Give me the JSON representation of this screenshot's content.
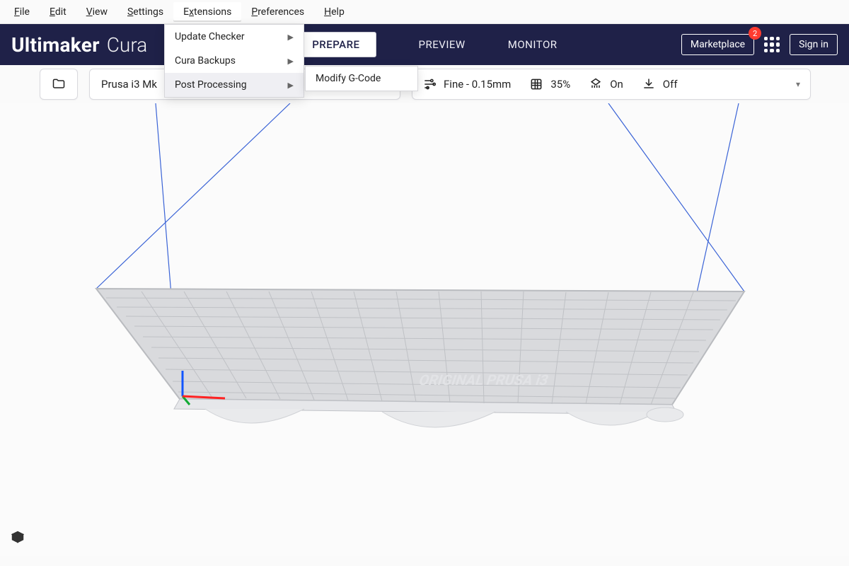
{
  "menubar": {
    "items": [
      {
        "under": "F",
        "rest": "ile"
      },
      {
        "under": "E",
        "rest": "dit"
      },
      {
        "under": "V",
        "rest": "iew"
      },
      {
        "under": "S",
        "rest": "ettings"
      },
      {
        "under": "",
        "rest": "",
        "label": "Extensions",
        "under2": "x",
        "pre": "E",
        "post": "tensions"
      },
      {
        "under": "P",
        "rest": "references"
      },
      {
        "under": "H",
        "rest": "elp"
      }
    ],
    "file_pre": "",
    "file_u": "F",
    "file_post": "ile",
    "edit_pre": "",
    "edit_u": "E",
    "edit_post": "dit",
    "view_pre": "",
    "view_u": "V",
    "view_post": "iew",
    "settings_pre": "",
    "settings_u": "S",
    "settings_post": "ettings",
    "extensions_pre": "E",
    "extensions_u": "x",
    "extensions_post": "tensions",
    "preferences_pre": "",
    "preferences_u": "P",
    "preferences_post": "references",
    "help_pre": "",
    "help_u": "H",
    "help_post": "elp"
  },
  "dropdown": {
    "items": [
      {
        "label": "Update Checker"
      },
      {
        "label": "Cura Backups"
      },
      {
        "label": "Post Processing"
      }
    ],
    "submenu_label": "Modify G-Code"
  },
  "brand": {
    "line1": "Ultimaker",
    "line2": "Cura"
  },
  "tabs": {
    "prepare": "PREPARE",
    "preview": "PREVIEW",
    "monitor": "MONITOR"
  },
  "right": {
    "marketplace": "Marketplace",
    "signin": "Sign in",
    "badge": "2"
  },
  "printer": {
    "name": "Prusa i3 Mk"
  },
  "settings": {
    "quality": "Fine - 0.15mm",
    "infill": "35%",
    "support": "On",
    "adhesion": "Off"
  },
  "buildplate_text": "ORIGINAL PRUSA i3"
}
